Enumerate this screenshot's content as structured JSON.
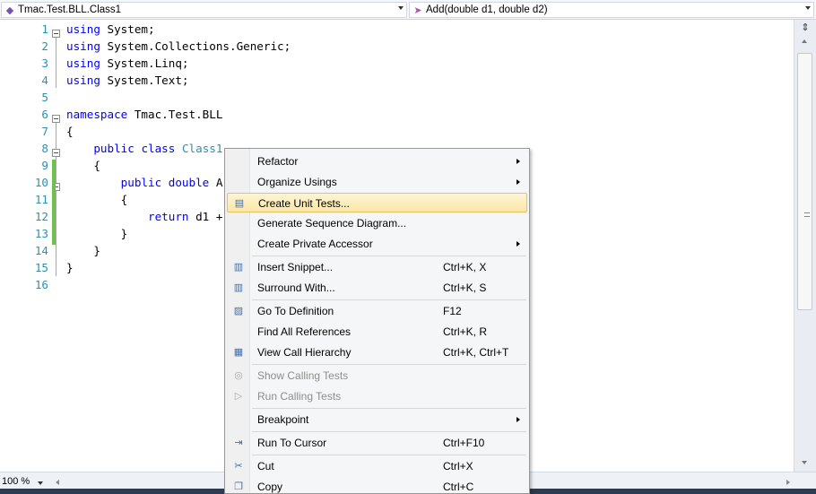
{
  "navigation": {
    "class_combo": {
      "icon": "class-icon",
      "text": "Tmac.Test.BLL.Class1"
    },
    "member_combo": {
      "icon": "method-icon",
      "text": "Add(double d1, double d2)"
    }
  },
  "editor": {
    "lines": [
      {
        "n": "1",
        "tokens": [
          {
            "t": "using",
            "k": "kw"
          },
          {
            "t": " System;",
            "k": ""
          }
        ]
      },
      {
        "n": "2",
        "tokens": [
          {
            "t": "using",
            "k": "kw"
          },
          {
            "t": " System.Collections.Generic;",
            "k": ""
          }
        ]
      },
      {
        "n": "3",
        "tokens": [
          {
            "t": "using",
            "k": "kw"
          },
          {
            "t": " System.Linq;",
            "k": ""
          }
        ]
      },
      {
        "n": "4",
        "tokens": [
          {
            "t": "using",
            "k": "kw"
          },
          {
            "t": " System.Text;",
            "k": ""
          }
        ]
      },
      {
        "n": "5",
        "tokens": []
      },
      {
        "n": "6",
        "tokens": [
          {
            "t": "namespace",
            "k": "kw"
          },
          {
            "t": " Tmac.Test.BLL",
            "k": ""
          }
        ]
      },
      {
        "n": "7",
        "tokens": [
          {
            "t": "{",
            "k": ""
          }
        ]
      },
      {
        "n": "8",
        "tokens": [
          {
            "t": "    ",
            "k": ""
          },
          {
            "t": "public",
            "k": "kw"
          },
          {
            "t": " ",
            "k": ""
          },
          {
            "t": "class",
            "k": "kw"
          },
          {
            "t": " ",
            "k": ""
          },
          {
            "t": "Class1",
            "k": "ty"
          }
        ]
      },
      {
        "n": "9",
        "tokens": [
          {
            "t": "    {",
            "k": ""
          }
        ]
      },
      {
        "n": "10",
        "tokens": [
          {
            "t": "        ",
            "k": ""
          },
          {
            "t": "public",
            "k": "kw"
          },
          {
            "t": " ",
            "k": ""
          },
          {
            "t": "double",
            "k": "kw"
          },
          {
            "t": " A",
            "k": ""
          }
        ]
      },
      {
        "n": "11",
        "tokens": [
          {
            "t": "        {",
            "k": ""
          }
        ]
      },
      {
        "n": "12",
        "tokens": [
          {
            "t": "            ",
            "k": ""
          },
          {
            "t": "return",
            "k": "kw"
          },
          {
            "t": " d1 +",
            "k": ""
          }
        ]
      },
      {
        "n": "13",
        "tokens": [
          {
            "t": "        }",
            "k": ""
          }
        ]
      },
      {
        "n": "14",
        "tokens": [
          {
            "t": "    }",
            "k": ""
          }
        ]
      },
      {
        "n": "15",
        "tokens": [
          {
            "t": "}",
            "k": ""
          }
        ]
      },
      {
        "n": "16",
        "tokens": []
      }
    ]
  },
  "context_menu": {
    "items": [
      {
        "label": "Refactor",
        "shortcut": "",
        "icon": "",
        "submenu": true,
        "disabled": false,
        "highlighted": false,
        "sep_before": false
      },
      {
        "label": "Organize Usings",
        "shortcut": "",
        "icon": "",
        "submenu": true,
        "disabled": false,
        "highlighted": false,
        "sep_before": false
      },
      {
        "label": "Create Unit Tests...",
        "shortcut": "",
        "icon": "unit-test-icon",
        "submenu": false,
        "disabled": false,
        "highlighted": true,
        "sep_before": false
      },
      {
        "label": "Generate Sequence Diagram...",
        "shortcut": "",
        "icon": "",
        "submenu": false,
        "disabled": false,
        "highlighted": false,
        "sep_before": false
      },
      {
        "label": "Create Private Accessor",
        "shortcut": "",
        "icon": "",
        "submenu": true,
        "disabled": false,
        "highlighted": false,
        "sep_before": false
      },
      {
        "label": "Insert Snippet...",
        "shortcut": "Ctrl+K, X",
        "icon": "snippet-icon",
        "submenu": false,
        "disabled": false,
        "highlighted": false,
        "sep_before": true
      },
      {
        "label": "Surround With...",
        "shortcut": "Ctrl+K, S",
        "icon": "surround-icon",
        "submenu": false,
        "disabled": false,
        "highlighted": false,
        "sep_before": false
      },
      {
        "label": "Go To Definition",
        "shortcut": "F12",
        "icon": "definition-icon",
        "submenu": false,
        "disabled": false,
        "highlighted": false,
        "sep_before": true
      },
      {
        "label": "Find All References",
        "shortcut": "Ctrl+K, R",
        "icon": "",
        "submenu": false,
        "disabled": false,
        "highlighted": false,
        "sep_before": false
      },
      {
        "label": "View Call Hierarchy",
        "shortcut": "Ctrl+K, Ctrl+T",
        "icon": "call-hierarchy-icon",
        "submenu": false,
        "disabled": false,
        "highlighted": false,
        "sep_before": false
      },
      {
        "label": "Show Calling Tests",
        "shortcut": "",
        "icon": "calling-tests-icon",
        "submenu": false,
        "disabled": true,
        "highlighted": false,
        "sep_before": true
      },
      {
        "label": "Run Calling Tests",
        "shortcut": "",
        "icon": "run-tests-icon",
        "submenu": false,
        "disabled": true,
        "highlighted": false,
        "sep_before": false
      },
      {
        "label": "Breakpoint",
        "shortcut": "",
        "icon": "",
        "submenu": true,
        "disabled": false,
        "highlighted": false,
        "sep_before": true
      },
      {
        "label": "Run To Cursor",
        "shortcut": "Ctrl+F10",
        "icon": "run-to-cursor-icon",
        "submenu": false,
        "disabled": false,
        "highlighted": false,
        "sep_before": true
      },
      {
        "label": "Cut",
        "shortcut": "Ctrl+X",
        "icon": "cut-icon",
        "submenu": false,
        "disabled": false,
        "highlighted": false,
        "sep_before": true
      },
      {
        "label": "Copy",
        "shortcut": "Ctrl+C",
        "icon": "copy-icon",
        "submenu": false,
        "disabled": false,
        "highlighted": false,
        "sep_before": false
      }
    ]
  },
  "statusbar": {
    "zoom": "100 %"
  },
  "colors": {
    "keyword": "#0000ff",
    "type": "#2b91af",
    "line_number": "#2b91af",
    "changed_marker": "#6cc24a",
    "menu_highlight": "#fbe7a8"
  }
}
